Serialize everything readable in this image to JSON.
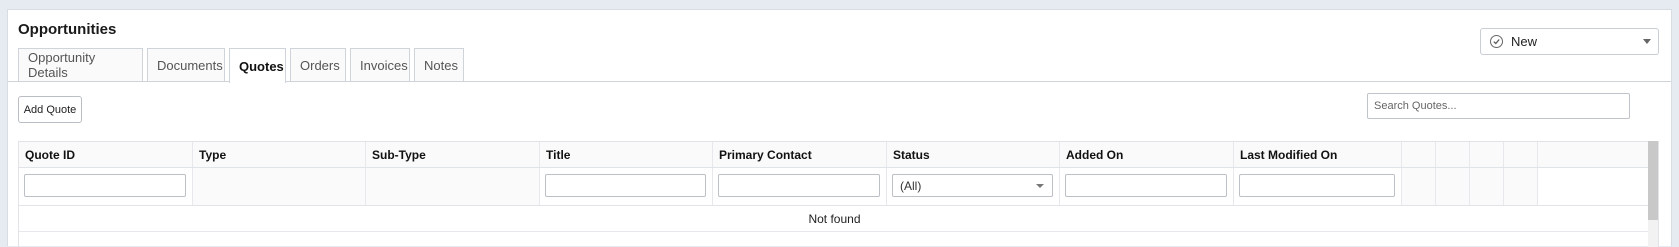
{
  "page": {
    "title": "Opportunities"
  },
  "tabs": [
    {
      "label": "Opportunity Details"
    },
    {
      "label": "Documents"
    },
    {
      "label": "Quotes",
      "active": true
    },
    {
      "label": "Orders"
    },
    {
      "label": "Invoices"
    },
    {
      "label": "Notes"
    }
  ],
  "status_select": {
    "value": "New",
    "icon": "check-circle-icon"
  },
  "toolbar": {
    "add_label": "Add Quote"
  },
  "search": {
    "placeholder": "Search Quotes..."
  },
  "grid": {
    "columns": [
      "Quote ID",
      "Type",
      "Sub-Type",
      "Title",
      "Primary Contact",
      "Status",
      "Added On",
      "Last Modified On"
    ],
    "status_filter": "(All)",
    "empty_message": "Not found"
  },
  "colors": {
    "background": "#e6ebf1",
    "panel": "#ffffff",
    "border": "#cfd4da"
  }
}
